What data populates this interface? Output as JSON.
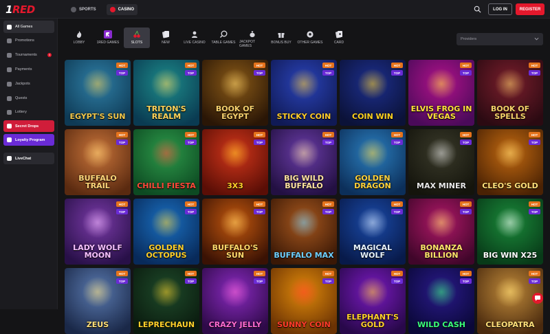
{
  "header": {
    "logo_prefix": "1",
    "logo_text": "RED",
    "nav": [
      {
        "label": "SPORTS",
        "active": false
      },
      {
        "label": "CASINO",
        "active": true
      }
    ],
    "login_label": "LOG IN",
    "register_label": "REGISTER"
  },
  "sidebar": {
    "items": [
      {
        "label": "All Games",
        "active": true
      },
      {
        "label": "Promotions",
        "active": false
      },
      {
        "label": "Tournaments",
        "active": false,
        "badge": "4"
      },
      {
        "label": "Payments",
        "active": false
      },
      {
        "label": "Jackpots",
        "active": false
      },
      {
        "label": "Quests",
        "active": false
      },
      {
        "label": "Lottery",
        "active": false
      }
    ],
    "promos": [
      {
        "label": "Secret Drops"
      },
      {
        "label": "Loyalty Program"
      },
      {
        "label": "LiveChat"
      }
    ]
  },
  "categories": [
    {
      "label": "LOBBY",
      "icon": "flame-icon",
      "active": false
    },
    {
      "label": "1RED GAMES",
      "icon": "1red-logo-icon",
      "active": false
    },
    {
      "label": "SLOTS",
      "icon": "cherries-icon",
      "active": true
    },
    {
      "label": "NEW",
      "icon": "new-cards-icon",
      "active": false
    },
    {
      "label": "LIVE CASINO",
      "icon": "dealer-icon",
      "active": false
    },
    {
      "label": "TABLE GAMES",
      "icon": "chip-icon",
      "active": false
    },
    {
      "label": "JACKPOT GAMES",
      "icon": "money-bag-icon",
      "active": false
    },
    {
      "label": "BONUS BUY",
      "icon": "gift-icon",
      "active": false
    },
    {
      "label": "OTHER GAMES",
      "icon": "ball-icon",
      "active": false
    },
    {
      "label": "CARD",
      "icon": "cards-icon",
      "active": false
    }
  ],
  "providers": {
    "placeholder": "Providers"
  },
  "games": [
    {
      "title": "EGYPT'S SUN",
      "hot": true,
      "top": true,
      "bg": "#2f7fa6",
      "bg2": "#0e3a55",
      "fg": "#f2c84b"
    },
    {
      "title": "TRITON'S REALM",
      "hot": true,
      "top": true,
      "bg": "#1d8b8a",
      "bg2": "#0a3b52",
      "fg": "#ffd45a"
    },
    {
      "title": "BOOK OF EGYPT",
      "hot": true,
      "top": true,
      "bg": "#8a5a17",
      "bg2": "#2a1606",
      "fg": "#f7d16e"
    },
    {
      "title": "STICKY COIN",
      "hot": true,
      "top": true,
      "bg": "#2a43b9",
      "bg2": "#101a55",
      "fg": "#ffcc2a"
    },
    {
      "title": "COIN WIN",
      "hot": true,
      "top": true,
      "bg": "#1d2f8e",
      "bg2": "#0b1238",
      "fg": "#ffd21f"
    },
    {
      "title": "ELVIS FROG IN VEGAS",
      "hot": true,
      "top": true,
      "bg": "#b1128a",
      "bg2": "#4a0a5a",
      "fg": "#ffe23a"
    },
    {
      "title": "BOOK OF SPELLS",
      "hot": true,
      "top": true,
      "bg": "#7a1e2c",
      "bg2": "#2b0a12",
      "fg": "#f7d36a"
    },
    {
      "title": "BUFFALO TRAIL",
      "hot": true,
      "top": true,
      "bg": "#c9743a",
      "bg2": "#5a2a10",
      "fg": "#ffd77a"
    },
    {
      "title": "CHILLI FIESTA",
      "hot": true,
      "top": true,
      "bg": "#2d9a4a",
      "bg2": "#0d4a22",
      "fg": "#ff4a3a"
    },
    {
      "title": "3X3",
      "hot": true,
      "top": true,
      "bg": "#d2361a",
      "bg2": "#5a0e06",
      "fg": "#ffd02a"
    },
    {
      "title": "BIG WILD BUFFALO",
      "hot": true,
      "top": true,
      "bg": "#6a3ca8",
      "bg2": "#231042",
      "fg": "#ffe4a0"
    },
    {
      "title": "GOLDEN DRAGON",
      "hot": true,
      "top": true,
      "bg": "#2b7fbf",
      "bg2": "#0c2f5a",
      "fg": "#ffd23a"
    },
    {
      "title": "MAX MINER",
      "hot": true,
      "top": true,
      "bg": "#3a3a2a",
      "bg2": "#14140c",
      "fg": "#e8e8e8"
    },
    {
      "title": "CLEO'S GOLD",
      "hot": true,
      "top": true,
      "bg": "#c46a10",
      "bg2": "#4a2204",
      "fg": "#ffe07a"
    },
    {
      "title": "LADY WOLF MOON",
      "hot": true,
      "top": true,
      "bg": "#7a3aa8",
      "bg2": "#281048",
      "fg": "#f6c0ff"
    },
    {
      "title": "GOLDEN OCTOPUS",
      "hot": true,
      "top": true,
      "bg": "#1a6fc0",
      "bg2": "#082a5a",
      "fg": "#ffd02a"
    },
    {
      "title": "BUFFALO'S SUN",
      "hot": true,
      "top": true,
      "bg": "#c4580e",
      "bg2": "#3a1204",
      "fg": "#ffd86a"
    },
    {
      "title": "BUFFALO MAX",
      "hot": true,
      "top": true,
      "bg": "#a8581e",
      "bg2": "#3a1806",
      "fg": "#6fd0ff"
    },
    {
      "title": "MAGICAL WOLF",
      "hot": true,
      "top": true,
      "bg": "#1a4aa8",
      "bg2": "#081a4a",
      "fg": "#e8f4ff"
    },
    {
      "title": "BONANZA BILLION",
      "hot": true,
      "top": true,
      "bg": "#b01868",
      "bg2": "#40062a",
      "fg": "#ffe46a"
    },
    {
      "title": "BIG WIN X25",
      "hot": true,
      "top": true,
      "bg": "#1a8a3a",
      "bg2": "#083a18",
      "fg": "#ffffff"
    },
    {
      "title": "ZEUS",
      "hot": true,
      "top": true,
      "bg": "#5a7ab0",
      "bg2": "#1a2848",
      "fg": "#ffe07a"
    },
    {
      "title": "LEPRECHAUN",
      "hot": true,
      "top": true,
      "bg": "#1e4a2a",
      "bg2": "#0a1a0e",
      "fg": "#ffd02a"
    },
    {
      "title": "CRAZY JELLY",
      "hot": true,
      "top": true,
      "bg": "#8a2ac0",
      "bg2": "#2e0a48",
      "fg": "#ff6ad0"
    },
    {
      "title": "SUNNY COIN",
      "hot": true,
      "top": true,
      "bg": "#e08a0a",
      "bg2": "#6a3204",
      "fg": "#ff3a2a"
    },
    {
      "title": "ELEPHANT'S GOLD",
      "hot": true,
      "top": true,
      "bg": "#7a1ac0",
      "bg2": "#28084a",
      "fg": "#ffd02a"
    },
    {
      "title": "WILD CASH",
      "hot": true,
      "top": true,
      "bg": "#2a1a8a",
      "bg2": "#0a0838",
      "fg": "#3aff7a"
    },
    {
      "title": "CLEOPATRA",
      "hot": true,
      "top": true,
      "bg": "#c08a3a",
      "bg2": "#4a2a0e",
      "fg": "#ffe07a"
    }
  ],
  "tags": {
    "hot": "HOT",
    "top": "TOP"
  },
  "colors": {
    "accent": "#e4182c",
    "hot": "#e5731c",
    "top": "#6a2bd6"
  }
}
